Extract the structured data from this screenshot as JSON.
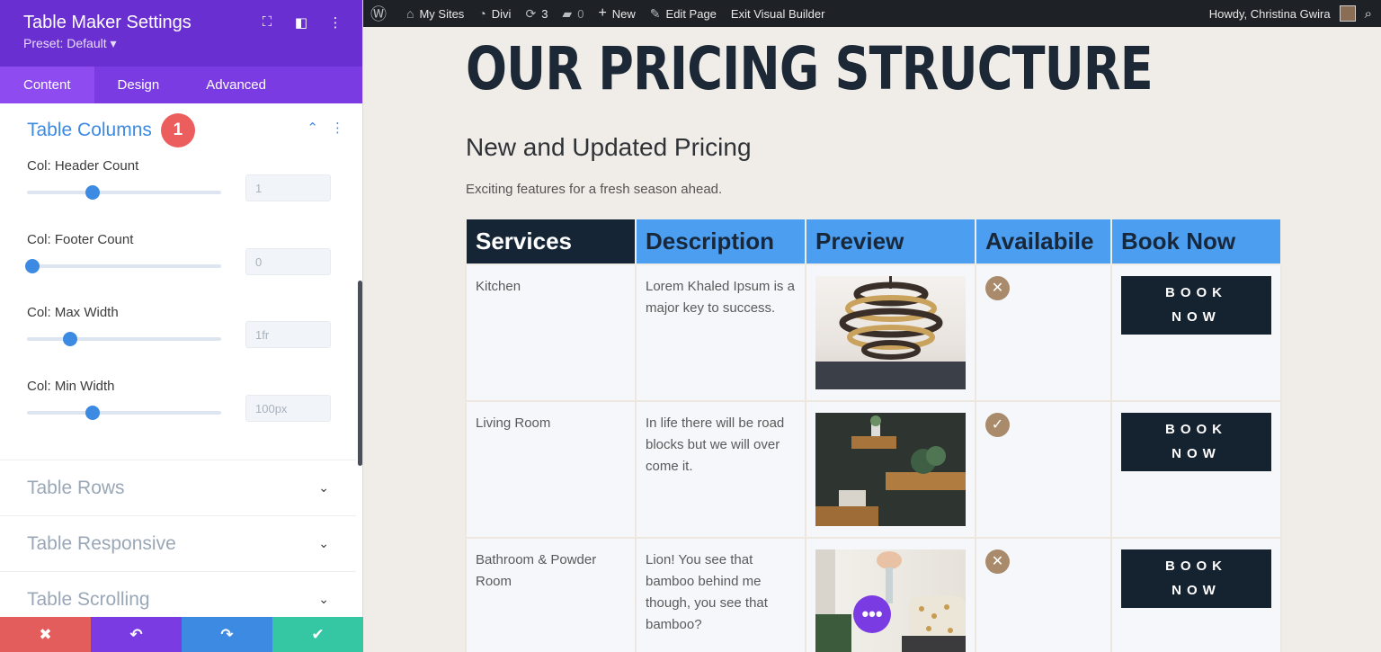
{
  "panel": {
    "title": "Table Maker Settings",
    "preset": "Preset: Default ▾",
    "tabs": [
      "Content",
      "Design",
      "Advanced"
    ],
    "section": {
      "title": "Table Columns",
      "badge": "1",
      "fields": [
        {
          "label": "Col: Header Count",
          "value": "1",
          "level": 0.34
        },
        {
          "label": "Col: Footer Count",
          "value": "0",
          "level": 0.03
        },
        {
          "label": "Col: Max Width",
          "value": "1fr",
          "level": 0.22
        },
        {
          "label": "Col: Min Width",
          "value": "100px",
          "level": 0.34
        }
      ]
    },
    "collapsed": [
      "Table Rows",
      "Table Responsive",
      "Table Scrolling"
    ],
    "bottom_colors": [
      "#e35d5d",
      "#7b3be3",
      "#3d8ae2",
      "#35c6a3"
    ]
  },
  "adminbar": {
    "my_sites": "My Sites",
    "divi": "Divi",
    "updates": "3",
    "comments": "0",
    "new": "New",
    "edit_page": "Edit Page",
    "exit": "Exit Visual Builder",
    "howdy": "Howdy, Christina Gwira"
  },
  "page": {
    "heading": "OUR PRICING STRUCTURE",
    "subheading": "New and Updated Pricing",
    "description": "Exciting features for a fresh season ahead.",
    "columns": [
      "Services",
      "Description",
      "Preview",
      "Availabile",
      "Book Now"
    ],
    "rows": [
      {
        "service": "Kitchen",
        "description": "Lorem Khaled Ipsum is a major key to success.",
        "available": false,
        "preview": "chandelier"
      },
      {
        "service": "Living Room",
        "description": "In life there will be road blocks but we will over come it.",
        "available": true,
        "preview": "wall-shelves"
      },
      {
        "service": "Bathroom & Powder Room",
        "description": "Lion! You see that bamboo behind me though, you see that bamboo?",
        "available": false,
        "preview": "cushions"
      }
    ],
    "book_line1": "BOOK",
    "book_line2": "NOW"
  }
}
